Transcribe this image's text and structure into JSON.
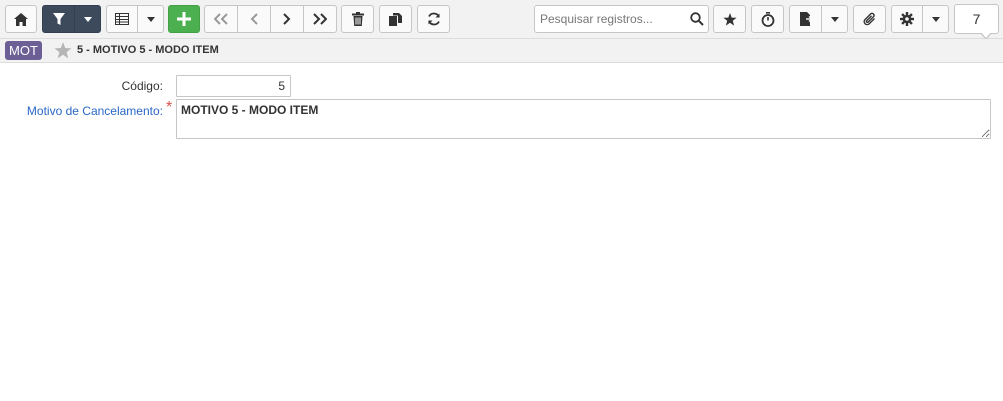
{
  "toolbar": {
    "search_placeholder": "Pesquisar registros...",
    "record_count": "7",
    "icons": [
      "home-icon",
      "filter-icon",
      "table-icon",
      "add-icon",
      "first-icon",
      "prev-icon",
      "next-icon",
      "last-icon",
      "delete-icon",
      "copy-icon",
      "refresh-icon",
      "search-icon",
      "favorite-icon",
      "timer-icon",
      "report-icon",
      "attachment-icon",
      "gear-icon",
      "caret-down-icon"
    ]
  },
  "colors": {
    "dark_button": "#3d4a5c",
    "add_button": "#4caf50",
    "badge": "#6b5f95",
    "link_label": "#2a67c7",
    "required": "#d9534f"
  },
  "header": {
    "badge": "MOT",
    "title": "5 - MOTIVO 5 - MODO ITEM"
  },
  "form": {
    "codigo_label": "Código:",
    "codigo_value": "5",
    "motivo_label": "Motivo de Cancelamento:",
    "required_mark": "*",
    "motivo_value": "MOTIVO 5 - MODO ITEM"
  }
}
